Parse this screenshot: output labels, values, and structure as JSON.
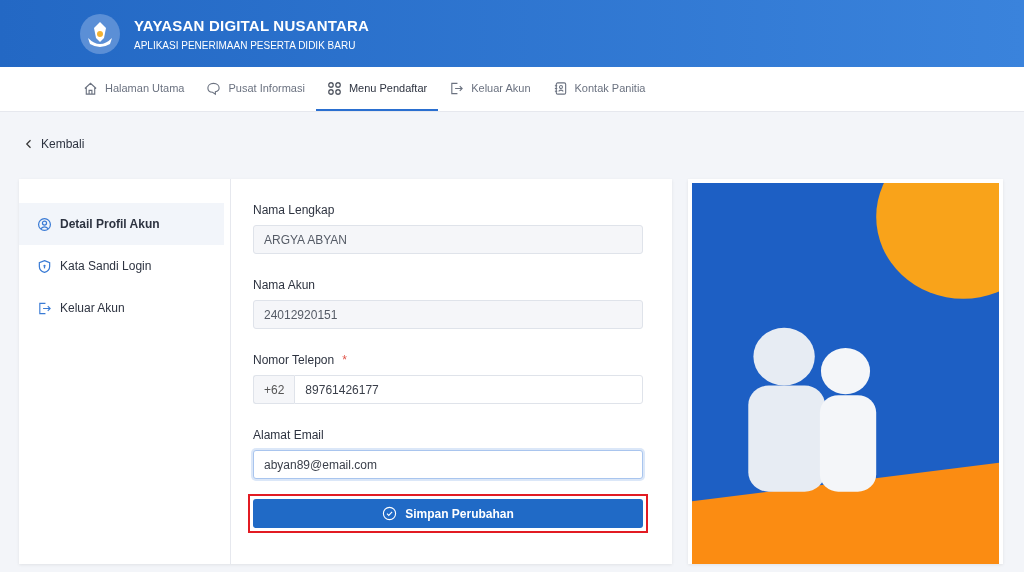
{
  "header": {
    "title": "YAYASAN DIGITAL NUSANTARA",
    "subtitle": "APLIKASI PENERIMAAN PESERTA DIDIK BARU"
  },
  "nav": [
    {
      "label": "Halaman Utama",
      "selected": false
    },
    {
      "label": "Pusat Informasi",
      "selected": false
    },
    {
      "label": "Menu Pendaftar",
      "selected": true
    },
    {
      "label": "Keluar Akun",
      "selected": false
    },
    {
      "label": "Kontak Panitia",
      "selected": false
    }
  ],
  "back_link": "Kembali",
  "sidebar": {
    "items": [
      {
        "label": "Detail Profil Akun",
        "selected": true
      },
      {
        "label": "Kata Sandi Login",
        "selected": false
      },
      {
        "label": "Keluar Akun",
        "selected": false
      }
    ]
  },
  "form": {
    "fields": [
      {
        "label": "Nama Lengkap",
        "value": "ARGYA ABYAN",
        "disabled": true,
        "focused": false
      },
      {
        "label": "Nama Akun",
        "value": "24012920151",
        "disabled": true,
        "focused": false
      },
      {
        "label": "Nomor Telepon",
        "required_mark": "*",
        "prefix": "+62",
        "value": "89761426177",
        "disabled": false,
        "focused": false
      },
      {
        "label": "Alamat Email",
        "value": "abyan89@email.com",
        "disabled": false,
        "focused": true
      }
    ],
    "submit": {
      "label": "Simpan Perubahan",
      "highlighted": true
    }
  }
}
